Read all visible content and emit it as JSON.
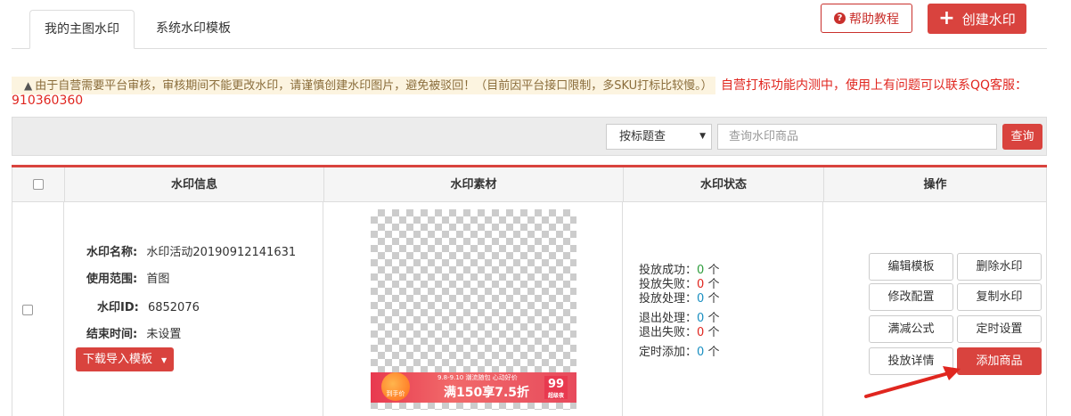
{
  "tabs": [
    {
      "label": "我的主图水印",
      "active": true
    },
    {
      "label": "系统水印模板",
      "active": false
    }
  ],
  "header_buttons": {
    "help_label": "帮助教程",
    "help_icon": "question-circle-icon",
    "create_label": "创建水印",
    "create_icon": "plus-icon"
  },
  "notice": {
    "warn_icon": "warning-triangle-icon",
    "text": "由于自营需要平台审核，审核期间不能更改水印，请谨慎创建水印图片，避免被驳回！（目前因平台接口限制，多SKU打标比较慢。）",
    "red_text": "自营打标功能内测中，使用上有问题可以联系QQ客服：",
    "qq": "910360360"
  },
  "search": {
    "select_value": "按标题查",
    "placeholder": "查询水印商品",
    "query_label": "查询"
  },
  "table": {
    "headers": [
      "水印信息",
      "水印素材",
      "水印状态",
      "操作"
    ],
    "row": {
      "info": {
        "name_label": "水印名称:",
        "name_value": "水印活动20190912141631",
        "scope_label": "使用范围:",
        "scope_value": "首图",
        "id_label": "水印ID:",
        "id_value": "6852076",
        "end_label": "结束时间:",
        "end_value": "未设置",
        "download_label": "下载导入模板"
      },
      "material": {
        "banner_top": "9.8-9.10 潮流随包 心动好价",
        "banner_main": "满150享7.5折",
        "circle_text": "到手价",
        "badge_number": "99",
        "badge_text": "超级夜"
      },
      "status": [
        {
          "label": "投放成功：",
          "value": "0",
          "unit": "个",
          "color": "green"
        },
        {
          "label": "投放失败：",
          "value": "0",
          "unit": "个",
          "color": "red"
        },
        {
          "label": "投放处理：",
          "value": "0",
          "unit": "个",
          "color": "blue"
        },
        {
          "label": "退出处理：",
          "value": "0",
          "unit": "个",
          "color": "blue"
        },
        {
          "label": "退出失败：",
          "value": "0",
          "unit": "个",
          "color": "red"
        },
        {
          "label": "定时添加：",
          "value": "0",
          "unit": "个",
          "color": "blue"
        }
      ],
      "actions": [
        "编辑模板",
        "删除水印",
        "修改配置",
        "复制水印",
        "满减公式",
        "定时设置",
        "投放详情",
        "添加商品"
      ]
    }
  },
  "colors": {
    "accent": "#d9433e",
    "green": "#2e9d3c",
    "red": "#e0261f",
    "blue": "#1a8fc1"
  }
}
